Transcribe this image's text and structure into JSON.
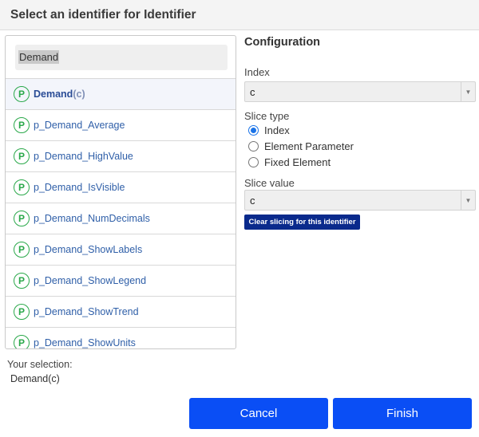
{
  "dialog": {
    "title": "Select an identifier for Identifier"
  },
  "search": {
    "value": "Demand"
  },
  "items": [
    {
      "name": "Demand",
      "suffix": "(c)",
      "badge": "P"
    },
    {
      "name": "p_Demand_Average",
      "suffix": "",
      "badge": "P"
    },
    {
      "name": "p_Demand_HighValue",
      "suffix": "",
      "badge": "P"
    },
    {
      "name": "p_Demand_IsVisible",
      "suffix": "",
      "badge": "P"
    },
    {
      "name": "p_Demand_NumDecimals",
      "suffix": "",
      "badge": "P"
    },
    {
      "name": "p_Demand_ShowLabels",
      "suffix": "",
      "badge": "P"
    },
    {
      "name": "p_Demand_ShowLegend",
      "suffix": "",
      "badge": "P"
    },
    {
      "name": "p_Demand_ShowTrend",
      "suffix": "",
      "badge": "P"
    },
    {
      "name": "p_Demand_ShowUnits",
      "suffix": "",
      "badge": "P"
    }
  ],
  "config": {
    "title": "Configuration",
    "index_label": "Index",
    "index_value": "c",
    "slice_type_label": "Slice type",
    "slice_options": [
      "Index",
      "Element Parameter",
      "Fixed Element"
    ],
    "slice_selected": "Index",
    "slice_value_label": "Slice value",
    "slice_value": "c",
    "clear_label": "Clear slicing for this identifier",
    "arrow_glyph": "▼"
  },
  "selection": {
    "label": "Your selection:",
    "value": "Demand(c)"
  },
  "buttons": {
    "cancel": "Cancel",
    "finish": "Finish"
  },
  "colors": {
    "primary": "#0a4ef5",
    "clear_button": "#0a2a8c",
    "badge": "#2aa84a"
  }
}
